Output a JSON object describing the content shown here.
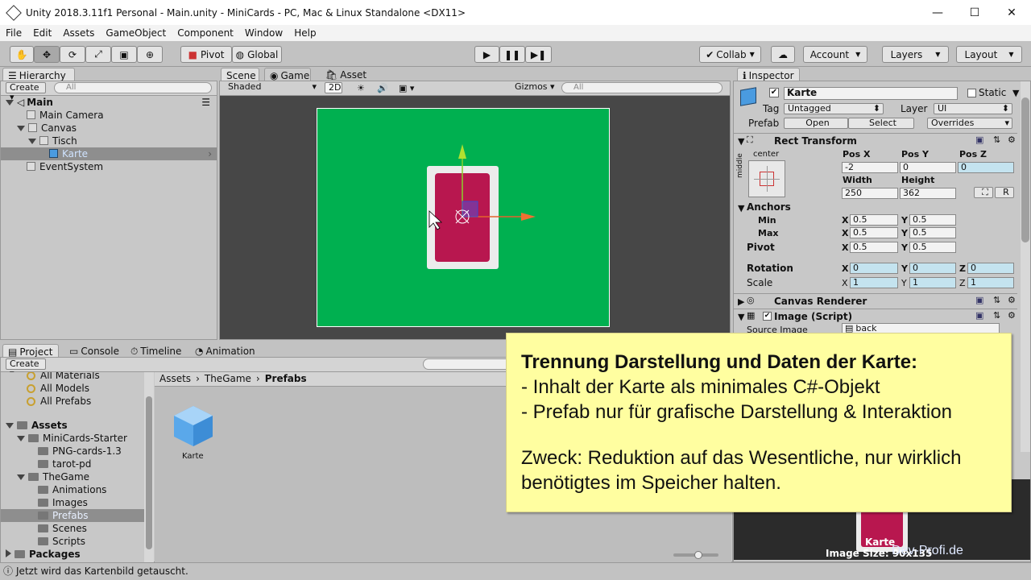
{
  "window": {
    "title": "Unity 2018.3.11f1 Personal - Main.unity - MiniCards - PC, Mac & Linux Standalone <DX11>"
  },
  "menu": [
    "File",
    "Edit",
    "Assets",
    "GameObject",
    "Component",
    "Window",
    "Help"
  ],
  "toolbar": {
    "pivot": "Pivot",
    "global": "Global",
    "collab": "Collab",
    "account": "Account",
    "layers": "Layers",
    "layout": "Layout"
  },
  "hierarchy": {
    "tab": "Hierarchy",
    "create": "Create",
    "search_placeholder": "All",
    "scene": "Main",
    "items": [
      "Main Camera",
      "Canvas",
      "Tisch",
      "Karte",
      "EventSystem"
    ]
  },
  "scene_view": {
    "tabs": [
      "Scene",
      "Game",
      "Asset Store"
    ],
    "shading": "Shaded",
    "mode2d": "2D",
    "gizmos": "Gizmos",
    "search_placeholder": "All",
    "colors": {
      "table": "#00b050",
      "card_back": "#b8174f",
      "card_frame": "#ececec",
      "background": "#474747"
    }
  },
  "inspector": {
    "tab": "Inspector",
    "object_name": "Karte",
    "static": "Static",
    "tag_label": "Tag",
    "tag": "Untagged",
    "layer_label": "Layer",
    "layer": "UI",
    "prefab_label": "Prefab",
    "open": "Open",
    "select": "Select",
    "overrides": "Overrides",
    "rect_transform": {
      "title": "Rect Transform",
      "anchor_h": "center",
      "anchor_v": "middle",
      "pos_x_label": "Pos X",
      "pos_y_label": "Pos Y",
      "pos_z_label": "Pos Z",
      "pos_x": "-2",
      "pos_y": "0",
      "pos_z": "0",
      "width_label": "Width",
      "height_label": "Height",
      "width": "250",
      "height": "362",
      "r_button": "R",
      "anchors_label": "Anchors",
      "min_label": "Min",
      "max_label": "Max",
      "min_x": "0.5",
      "min_y": "0.5",
      "max_x": "0.5",
      "max_y": "0.5",
      "pivot_label": "Pivot",
      "pivot_x": "0.5",
      "pivot_y": "0.5",
      "rotation_label": "Rotation",
      "rot_x": "0",
      "rot_y": "0",
      "rot_z": "0",
      "scale_label": "Scale",
      "scale_x": "1",
      "scale_y": "1",
      "scale_z": "1",
      "x": "X",
      "y": "Y",
      "z": "Z"
    },
    "canvas_renderer": "Canvas Renderer",
    "image_script": "Image (Script)",
    "source_image_label": "Source Image",
    "source_image": "back",
    "preview_name": "Karte",
    "preview_size": "Image Size: 90x135",
    "watermark": "Dev-Profi.de"
  },
  "project": {
    "tabs": [
      "Project",
      "Console",
      "Timeline",
      "Animation"
    ],
    "create": "Create",
    "favorites": [
      "All Materials",
      "All Models",
      "All Prefabs"
    ],
    "tree": [
      {
        "label": "Assets",
        "level": 0,
        "bold": true
      },
      {
        "label": "MiniCards-Starter",
        "level": 1
      },
      {
        "label": "PNG-cards-1.3",
        "level": 2
      },
      {
        "label": "tarot-pd",
        "level": 2
      },
      {
        "label": "TheGame",
        "level": 1
      },
      {
        "label": "Animations",
        "level": 2
      },
      {
        "label": "Images",
        "level": 2
      },
      {
        "label": "Prefabs",
        "level": 2
      },
      {
        "label": "Scenes",
        "level": 2
      },
      {
        "label": "Scripts",
        "level": 2
      },
      {
        "label": "Packages",
        "level": 0,
        "bold": true
      }
    ],
    "breadcrumb": [
      "Assets",
      "TheGame",
      "Prefabs"
    ],
    "asset": "Karte"
  },
  "callout": {
    "heading": "Trennung Darstellung und Daten der Karte:",
    "line1": "- Inhalt der Karte als minimales C#-Objekt",
    "line2": "- Prefab nur für grafische Darstellung & Interaktion",
    "purpose": "Zweck: Reduktion auf das Wesentliche, nur wirklich benötigtes im Speicher halten."
  },
  "status": "Jetzt wird das Kartenbild getauscht."
}
